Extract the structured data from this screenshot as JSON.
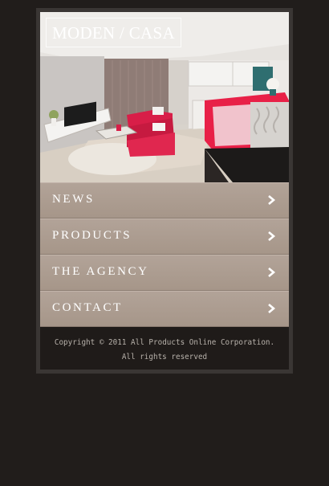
{
  "header": {
    "logo": "MODEN / CASA"
  },
  "menu": {
    "items": [
      {
        "label": "NEWS"
      },
      {
        "label": "PRODUCTS"
      },
      {
        "label": "THE AGENCY"
      },
      {
        "label": "CONTACT"
      }
    ]
  },
  "footer": {
    "line1": "Copyright © 2011 All Products Online Corporation.",
    "line2": "All rights reserved"
  },
  "colors": {
    "page_background": "#211d1b",
    "menu_item": "#ac9d91",
    "sofa_accent": "#d81e48"
  }
}
